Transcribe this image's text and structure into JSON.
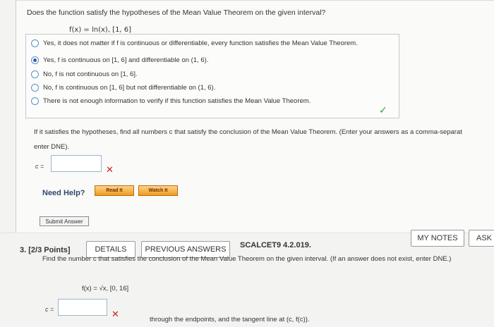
{
  "q2": {
    "question": "Does the function satisfy the hypotheses of the Mean Value Theorem on the given interval?",
    "function": "f(x) = ln(x),    [1, 6]",
    "options": [
      {
        "label": "Yes, it does not matter if f is continuous or differentiable, every function satisfies the Mean Value Theorem.",
        "selected": false
      },
      {
        "label": "Yes, f is continuous on [1, 6] and differentiable on (1, 6).",
        "selected": true
      },
      {
        "label": "No, f is not continuous on [1, 6].",
        "selected": false
      },
      {
        "label": "No, f is continuous on [1, 6] but not differentiable on (1, 6).",
        "selected": false
      },
      {
        "label": "There is not enough information to verify if this function satisfies the Mean Value Theorem.",
        "selected": false
      }
    ],
    "check_mark": "✓",
    "instruction_line1": "If it satisfies the hypotheses, find all numbers c that satisfy the conclusion of the Mean Value Theorem. (Enter your answers as a comma-separat",
    "instruction_line2": "enter DNE).",
    "c_label": "c =",
    "answer_value": "",
    "x_mark": "✕",
    "need_help": "Need Help?",
    "read_it": "Read It",
    "watch_it": "Watch It",
    "submit": "Submit Answer"
  },
  "q3": {
    "number_label": "3.  [2/3 Points]",
    "details": "DETAILS",
    "previous_answers": "PREVIOUS ANSWERS",
    "code": "SCALCET9 4.2.019.",
    "my_notes": "MY NOTES",
    "ask": "ASK",
    "find_text": "Find the number c that satisfies the conclusion of the Mean Value Theorem on the given interval. (If an answer does not exist, enter DNE.)",
    "function": "f(x) = √x,    [0, 16]",
    "c_label": "c =",
    "answer_value": "",
    "x_mark": "✕",
    "tail_text": "through the endpoints, and the tangent line at (c, f(c))."
  },
  "colors": {
    "accent": "#2f5ba8",
    "correct": "#3a9a3a",
    "incorrect": "#d02020",
    "help_button": "#f09a1e"
  }
}
